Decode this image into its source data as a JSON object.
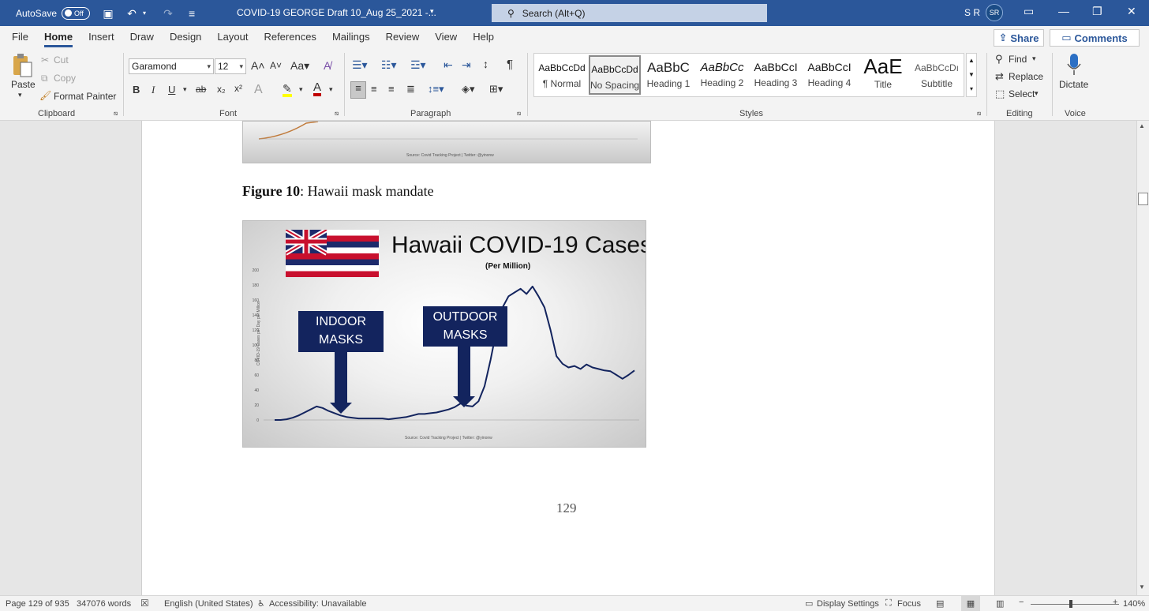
{
  "titlebar": {
    "autosave_label": "AutoSave",
    "autosave_state": "Off",
    "doc_title": "COVID-19 GEORGE Draft 10_Aug 25_2021  -...",
    "search_placeholder": "Search (Alt+Q)",
    "user_initials": "S R",
    "avatar_initials": "SR"
  },
  "tabs": [
    "File",
    "Home",
    "Insert",
    "Draw",
    "Design",
    "Layout",
    "References",
    "Mailings",
    "Review",
    "View",
    "Help"
  ],
  "share_label": "Share",
  "comments_label": "Comments",
  "clipboard": {
    "paste": "Paste",
    "cut": "Cut",
    "copy": "Copy",
    "format_painter": "Format Painter",
    "group": "Clipboard"
  },
  "font": {
    "family": "Garamond",
    "size": "12",
    "group": "Font"
  },
  "paragraph": {
    "group": "Paragraph"
  },
  "styles": {
    "group": "Styles",
    "items": [
      {
        "preview": "AaBbCcDd",
        "name": "¶ Normal"
      },
      {
        "preview": "AaBbCcDd",
        "name": "No Spacing"
      },
      {
        "preview": "AaBbC",
        "name": "Heading 1"
      },
      {
        "preview": "AaBbCc",
        "name": "Heading 2"
      },
      {
        "preview": "AaBbCcI",
        "name": "Heading 3"
      },
      {
        "preview": "AaBbCcI",
        "name": "Heading 4"
      },
      {
        "preview": "AaE",
        "name": "Title"
      },
      {
        "preview": "AaBbCcDı",
        "name": "Subtitle"
      }
    ]
  },
  "editing": {
    "find": "Find",
    "replace": "Replace",
    "select": "Select",
    "group": "Editing"
  },
  "voice": {
    "dictate": "Dictate",
    "group": "Voice"
  },
  "document": {
    "caption_bold": "Figure 10",
    "caption_rest": ": Hawaii mask mandate",
    "page_number": "129",
    "prev_chart_source": "Source: Covid Tracking Project | Twitter: @yinonw"
  },
  "figure": {
    "title": "Hawaii COVID-19 Cases",
    "subtitle": "(Per Million)",
    "ylabel": "COVID-19 Cases per Day per Million",
    "callouts": [
      "INDOOR MASKS",
      "OUTDOOR MASKS"
    ],
    "source": "Source: Covid Tracking Project | Twitter: @yinonw"
  },
  "chart_data": {
    "type": "line",
    "title": "Hawaii COVID-19 Cases",
    "subtitle": "(Per Million)",
    "ylabel": "COVID-19 Cases per Day per Million",
    "ylim": [
      0,
      200
    ],
    "yticks": [
      0,
      20,
      40,
      60,
      80,
      100,
      120,
      140,
      160,
      180,
      200
    ],
    "series": [
      {
        "color": "#13245e",
        "values": [
          0,
          0,
          1,
          3,
          6,
          10,
          14,
          18,
          16,
          12,
          9,
          6,
          4,
          3,
          2,
          2,
          2,
          2,
          2,
          1,
          2,
          3,
          4,
          6,
          8,
          8,
          9,
          10,
          12,
          14,
          17,
          22,
          19,
          18,
          25,
          45,
          80,
          120,
          150,
          165,
          170,
          175,
          168,
          178,
          165,
          150,
          120,
          85,
          75,
          70,
          72,
          68,
          74,
          70,
          68,
          66,
          65,
          60,
          55,
          60,
          66
        ]
      }
    ],
    "annotations": [
      "INDOOR MASKS",
      "OUTDOOR MASKS"
    ]
  },
  "status": {
    "page": "Page 129 of 935",
    "words": "347076 words",
    "language": "English (United States)",
    "accessibility": "Accessibility: Unavailable",
    "display_settings": "Display Settings",
    "focus": "Focus",
    "zoom": "140%"
  }
}
